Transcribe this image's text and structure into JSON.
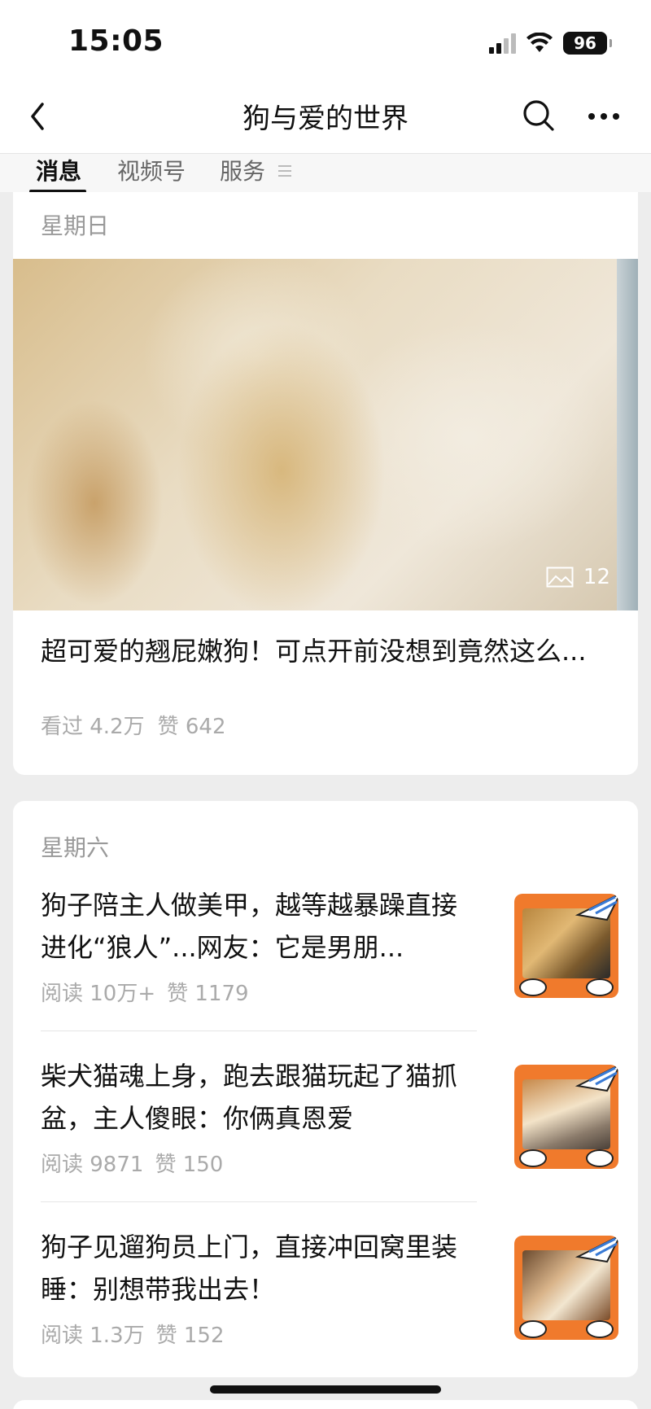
{
  "status_bar": {
    "time": "15:05",
    "battery": "96",
    "icons": [
      "signal-icon",
      "wifi-icon",
      "battery-icon"
    ]
  },
  "nav": {
    "title": "狗与爱的世界",
    "icons": [
      "back-icon",
      "search-icon",
      "more-icon"
    ]
  },
  "tabs": [
    {
      "label": "消息",
      "active": true
    },
    {
      "label": "视频号",
      "active": false
    },
    {
      "label": "服务",
      "active": false
    }
  ],
  "sections": [
    {
      "day": "星期日",
      "hero": {
        "image_count": "12",
        "title": "超可爱的翘屁嫩狗！可点开前没想到竟然这么...",
        "views": "看过 4.2万",
        "likes": "赞 642"
      }
    },
    {
      "day": "星期六",
      "articles": [
        {
          "title": "狗子陪主人做美甲，越等越暴躁直接进化“狼人”...网友：它是男朋...",
          "reads": "阅读 10万+",
          "likes": "赞 1179"
        },
        {
          "title": "柴犬猫魂上身，跑去跟猫玩起了猫抓盆，主人傻眼：你俩真恩爱",
          "reads": "阅读 9871",
          "likes": "赞 150"
        },
        {
          "title": "狗子见遛狗员上门，直接冲回窝里装睡：别想带我出去！",
          "reads": "阅读 1.3万",
          "likes": "赞 152"
        }
      ]
    }
  ],
  "colors": {
    "background": "#ededed",
    "card": "#ffffff",
    "meta_text": "#aaaaaa",
    "thumb_frame": "#f07a2c"
  }
}
